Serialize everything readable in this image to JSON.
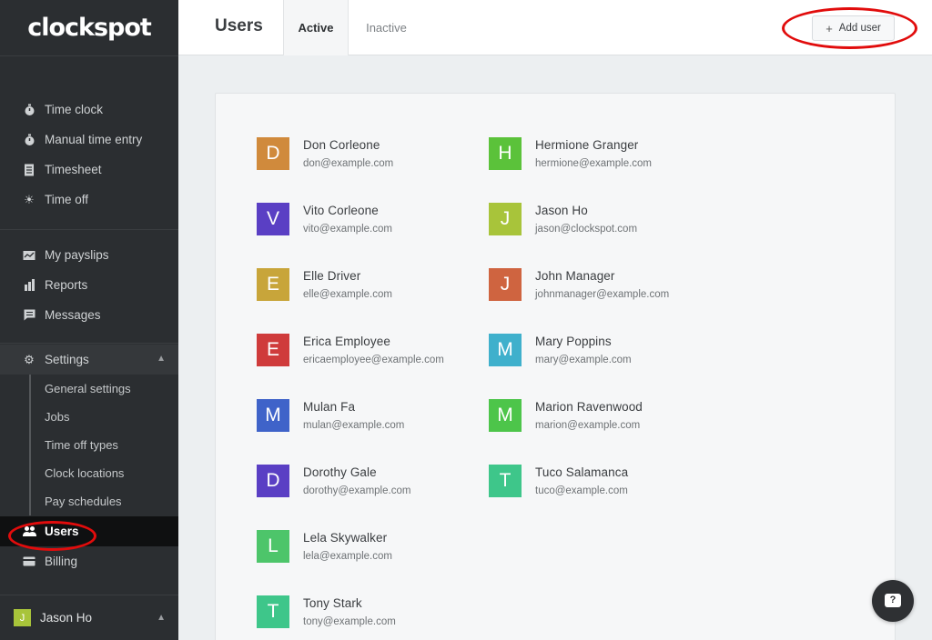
{
  "app": {
    "logo": "clockspot"
  },
  "sidebar": {
    "group1": [
      {
        "label": "Time clock",
        "icon": "stopwatch-icon"
      },
      {
        "label": "Manual time entry",
        "icon": "stopwatch-icon"
      },
      {
        "label": "Timesheet",
        "icon": "document-icon"
      },
      {
        "label": "Time off",
        "icon": "sun-icon"
      }
    ],
    "group2": [
      {
        "label": "My payslips",
        "icon": "payslip-icon"
      },
      {
        "label": "Reports",
        "icon": "bar-chart-icon"
      },
      {
        "label": "Messages",
        "icon": "message-icon"
      }
    ],
    "settings_label": "Settings",
    "settings_sub": [
      "General settings",
      "Jobs",
      "Time off types",
      "Clock locations",
      "Pay schedules"
    ],
    "users_label": "Users",
    "billing_label": "Billing",
    "current_user": {
      "initial": "J",
      "name": "Jason Ho"
    }
  },
  "header": {
    "title": "Users",
    "tabs": {
      "active": "Active",
      "inactive": "Inactive"
    },
    "add_user_label": "Add user"
  },
  "users": [
    {
      "initial": "D",
      "name": "Don Corleone",
      "email": "don@example.com",
      "color": "#d08a3c"
    },
    {
      "initial": "V",
      "name": "Vito Corleone",
      "email": "vito@example.com",
      "color": "#5a3fc4"
    },
    {
      "initial": "E",
      "name": "Elle Driver",
      "email": "elle@example.com",
      "color": "#c8a53a"
    },
    {
      "initial": "E",
      "name": "Erica Employee",
      "email": "ericaemployee@example.com",
      "color": "#cf3b3b"
    },
    {
      "initial": "M",
      "name": "Mulan Fa",
      "email": "mulan@example.com",
      "color": "#3f63c9"
    },
    {
      "initial": "D",
      "name": "Dorothy Gale",
      "email": "dorothy@example.com",
      "color": "#5a3fc4"
    },
    {
      "initial": "L",
      "name": "Lela Skywalker",
      "email": "lela@example.com",
      "color": "#4dc56a"
    },
    {
      "initial": "T",
      "name": "Tony Stark",
      "email": "tony@example.com",
      "color": "#3ec68a"
    },
    {
      "initial": "H",
      "name": "Hermione Granger",
      "email": "hermione@example.com",
      "color": "#5bc23a"
    },
    {
      "initial": "J",
      "name": "Jason Ho",
      "email": "jason@clockspot.com",
      "color": "#a8c43a"
    },
    {
      "initial": "J",
      "name": "John Manager",
      "email": "johnmanager@example.com",
      "color": "#cf6440"
    },
    {
      "initial": "M",
      "name": "Mary Poppins",
      "email": "mary@example.com",
      "color": "#3fb0cc"
    },
    {
      "initial": "M",
      "name": "Marion Ravenwood",
      "email": "marion@example.com",
      "color": "#4dc54a"
    },
    {
      "initial": "T",
      "name": "Tuco Salamanca",
      "email": "tuco@example.com",
      "color": "#3ec68a"
    }
  ],
  "help": {
    "label": "?"
  }
}
